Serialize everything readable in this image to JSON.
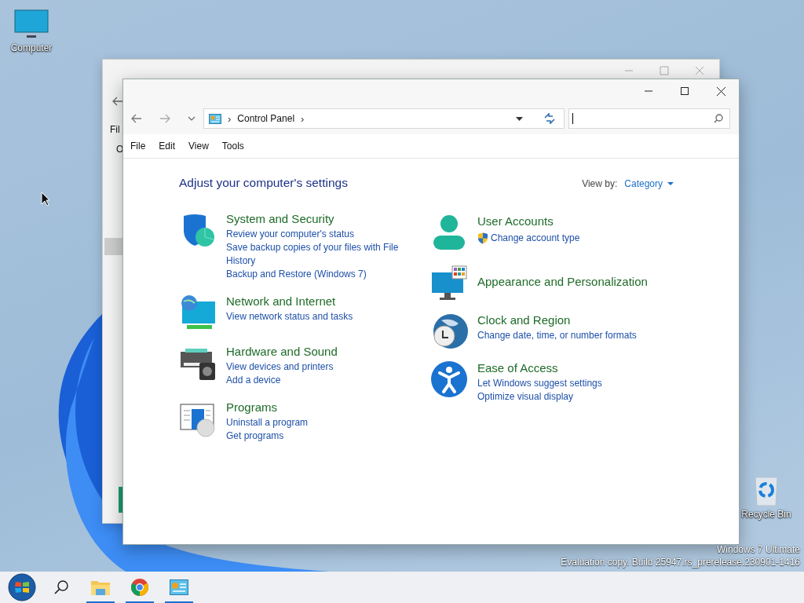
{
  "desktop_icons": [
    {
      "label": "Computer"
    },
    {
      "label": "Recycle Bin"
    }
  ],
  "background_window": {
    "menu_text": "Fil",
    "toolbar_text": "O"
  },
  "window": {
    "address": {
      "separator": "›",
      "segments": [
        "Control Panel"
      ]
    },
    "menu": [
      "File",
      "Edit",
      "View",
      "Tools"
    ]
  },
  "content": {
    "heading": "Adjust your computer's settings",
    "view_by": {
      "label": "View by:",
      "value": "Category"
    },
    "columns": [
      [
        {
          "title": "System and Security",
          "links": [
            {
              "text": "Review your computer's status",
              "kind": "plain"
            },
            {
              "text": "Save backup copies of your files with File History",
              "kind": "plain"
            },
            {
              "text": "Backup and Restore (Windows 7)",
              "kind": "plain"
            }
          ]
        },
        {
          "title": "Network and Internet",
          "links": [
            {
              "text": "View network status and tasks",
              "kind": "plain"
            }
          ]
        },
        {
          "title": "Hardware and Sound",
          "links": [
            {
              "text": "View devices and printers",
              "kind": "plain"
            },
            {
              "text": "Add a device",
              "kind": "plain"
            }
          ]
        },
        {
          "title": "Programs",
          "links": [
            {
              "text": "Uninstall a program",
              "kind": "plain"
            },
            {
              "text": "Get programs",
              "kind": "plain"
            }
          ]
        }
      ],
      [
        {
          "title": "User Accounts",
          "links": [
            {
              "text": "Change account type",
              "kind": "admin"
            }
          ]
        },
        {
          "title": "Appearance and Personalization"
        },
        {
          "title": "Clock and Region",
          "links": [
            {
              "text": "Change date, time, or number formats",
              "kind": "plain"
            }
          ]
        },
        {
          "title": "Ease of Access",
          "links": [
            {
              "text": "Let Windows suggest settings",
              "kind": "plain"
            },
            {
              "text": "Optimize visual display",
              "kind": "plain"
            }
          ]
        }
      ]
    ]
  },
  "watermark": [
    "Windows 7 Ultimate",
    "Evaluation copy. Build 25947.rs_prerelease.230901-1416"
  ],
  "taskbar": {
    "apps": [
      {
        "kind": "start",
        "running": false
      },
      {
        "kind": "search",
        "running": false
      },
      {
        "kind": "explorer",
        "running": true
      },
      {
        "kind": "browser",
        "running": true
      },
      {
        "kind": "control-panel",
        "running": true
      }
    ]
  }
}
